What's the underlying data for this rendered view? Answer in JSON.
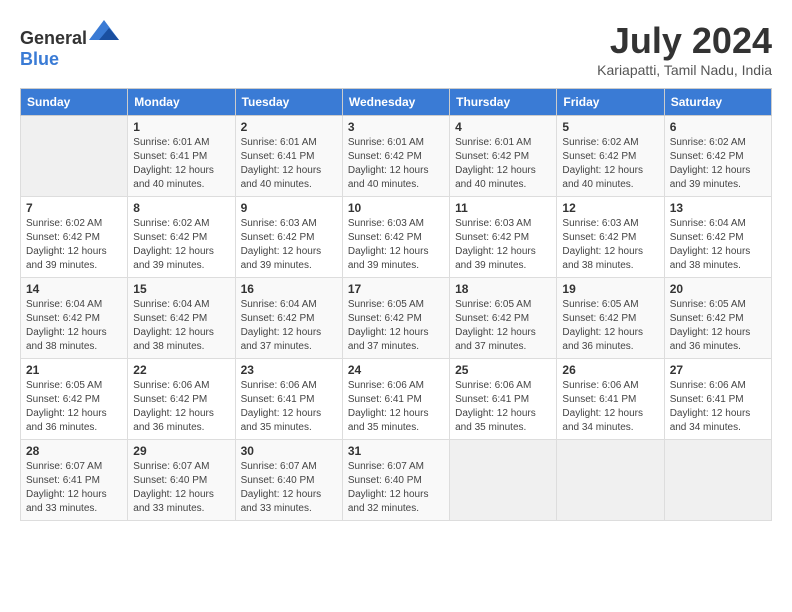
{
  "header": {
    "logo_general": "General",
    "logo_blue": "Blue",
    "month_year": "July 2024",
    "location": "Kariapatti, Tamil Nadu, India"
  },
  "calendar": {
    "days_of_week": [
      "Sunday",
      "Monday",
      "Tuesday",
      "Wednesday",
      "Thursday",
      "Friday",
      "Saturday"
    ],
    "weeks": [
      [
        {
          "day": "",
          "info": ""
        },
        {
          "day": "1",
          "info": "Sunrise: 6:01 AM\nSunset: 6:41 PM\nDaylight: 12 hours\nand 40 minutes."
        },
        {
          "day": "2",
          "info": "Sunrise: 6:01 AM\nSunset: 6:41 PM\nDaylight: 12 hours\nand 40 minutes."
        },
        {
          "day": "3",
          "info": "Sunrise: 6:01 AM\nSunset: 6:42 PM\nDaylight: 12 hours\nand 40 minutes."
        },
        {
          "day": "4",
          "info": "Sunrise: 6:01 AM\nSunset: 6:42 PM\nDaylight: 12 hours\nand 40 minutes."
        },
        {
          "day": "5",
          "info": "Sunrise: 6:02 AM\nSunset: 6:42 PM\nDaylight: 12 hours\nand 40 minutes."
        },
        {
          "day": "6",
          "info": "Sunrise: 6:02 AM\nSunset: 6:42 PM\nDaylight: 12 hours\nand 39 minutes."
        }
      ],
      [
        {
          "day": "7",
          "info": "Sunrise: 6:02 AM\nSunset: 6:42 PM\nDaylight: 12 hours\nand 39 minutes."
        },
        {
          "day": "8",
          "info": "Sunrise: 6:02 AM\nSunset: 6:42 PM\nDaylight: 12 hours\nand 39 minutes."
        },
        {
          "day": "9",
          "info": "Sunrise: 6:03 AM\nSunset: 6:42 PM\nDaylight: 12 hours\nand 39 minutes."
        },
        {
          "day": "10",
          "info": "Sunrise: 6:03 AM\nSunset: 6:42 PM\nDaylight: 12 hours\nand 39 minutes."
        },
        {
          "day": "11",
          "info": "Sunrise: 6:03 AM\nSunset: 6:42 PM\nDaylight: 12 hours\nand 39 minutes."
        },
        {
          "day": "12",
          "info": "Sunrise: 6:03 AM\nSunset: 6:42 PM\nDaylight: 12 hours\nand 38 minutes."
        },
        {
          "day": "13",
          "info": "Sunrise: 6:04 AM\nSunset: 6:42 PM\nDaylight: 12 hours\nand 38 minutes."
        }
      ],
      [
        {
          "day": "14",
          "info": "Sunrise: 6:04 AM\nSunset: 6:42 PM\nDaylight: 12 hours\nand 38 minutes."
        },
        {
          "day": "15",
          "info": "Sunrise: 6:04 AM\nSunset: 6:42 PM\nDaylight: 12 hours\nand 38 minutes."
        },
        {
          "day": "16",
          "info": "Sunrise: 6:04 AM\nSunset: 6:42 PM\nDaylight: 12 hours\nand 37 minutes."
        },
        {
          "day": "17",
          "info": "Sunrise: 6:05 AM\nSunset: 6:42 PM\nDaylight: 12 hours\nand 37 minutes."
        },
        {
          "day": "18",
          "info": "Sunrise: 6:05 AM\nSunset: 6:42 PM\nDaylight: 12 hours\nand 37 minutes."
        },
        {
          "day": "19",
          "info": "Sunrise: 6:05 AM\nSunset: 6:42 PM\nDaylight: 12 hours\nand 36 minutes."
        },
        {
          "day": "20",
          "info": "Sunrise: 6:05 AM\nSunset: 6:42 PM\nDaylight: 12 hours\nand 36 minutes."
        }
      ],
      [
        {
          "day": "21",
          "info": "Sunrise: 6:05 AM\nSunset: 6:42 PM\nDaylight: 12 hours\nand 36 minutes."
        },
        {
          "day": "22",
          "info": "Sunrise: 6:06 AM\nSunset: 6:42 PM\nDaylight: 12 hours\nand 36 minutes."
        },
        {
          "day": "23",
          "info": "Sunrise: 6:06 AM\nSunset: 6:41 PM\nDaylight: 12 hours\nand 35 minutes."
        },
        {
          "day": "24",
          "info": "Sunrise: 6:06 AM\nSunset: 6:41 PM\nDaylight: 12 hours\nand 35 minutes."
        },
        {
          "day": "25",
          "info": "Sunrise: 6:06 AM\nSunset: 6:41 PM\nDaylight: 12 hours\nand 35 minutes."
        },
        {
          "day": "26",
          "info": "Sunrise: 6:06 AM\nSunset: 6:41 PM\nDaylight: 12 hours\nand 34 minutes."
        },
        {
          "day": "27",
          "info": "Sunrise: 6:06 AM\nSunset: 6:41 PM\nDaylight: 12 hours\nand 34 minutes."
        }
      ],
      [
        {
          "day": "28",
          "info": "Sunrise: 6:07 AM\nSunset: 6:41 PM\nDaylight: 12 hours\nand 33 minutes."
        },
        {
          "day": "29",
          "info": "Sunrise: 6:07 AM\nSunset: 6:40 PM\nDaylight: 12 hours\nand 33 minutes."
        },
        {
          "day": "30",
          "info": "Sunrise: 6:07 AM\nSunset: 6:40 PM\nDaylight: 12 hours\nand 33 minutes."
        },
        {
          "day": "31",
          "info": "Sunrise: 6:07 AM\nSunset: 6:40 PM\nDaylight: 12 hours\nand 32 minutes."
        },
        {
          "day": "",
          "info": ""
        },
        {
          "day": "",
          "info": ""
        },
        {
          "day": "",
          "info": ""
        }
      ]
    ]
  }
}
